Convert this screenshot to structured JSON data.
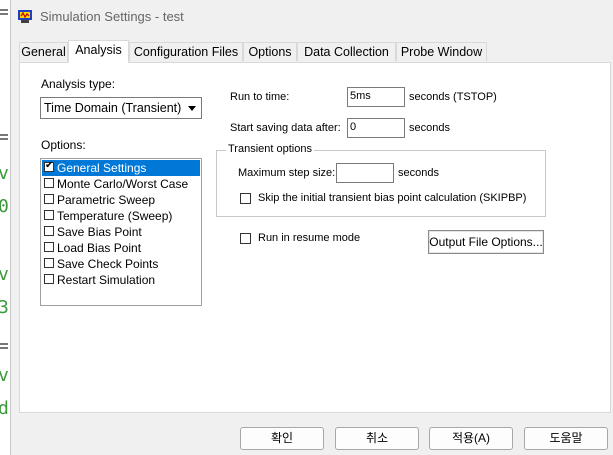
{
  "window": {
    "title": "Simulation Settings - test"
  },
  "tabs": [
    {
      "label": "General"
    },
    {
      "label": "Analysis"
    },
    {
      "label": "Configuration Files"
    },
    {
      "label": "Options"
    },
    {
      "label": "Data Collection"
    },
    {
      "label": "Probe Window"
    }
  ],
  "analysis": {
    "type_label": "Analysis type:",
    "type_value": "Time Domain (Transient)",
    "options_label": "Options:",
    "options": [
      {
        "label": "General Settings",
        "checked": true,
        "selected": true
      },
      {
        "label": "Monte Carlo/Worst Case",
        "checked": false
      },
      {
        "label": "Parametric Sweep",
        "checked": false
      },
      {
        "label": "Temperature (Sweep)",
        "checked": false
      },
      {
        "label": "Save Bias Point",
        "checked": false
      },
      {
        "label": "Load Bias Point",
        "checked": false
      },
      {
        "label": "Save Check Points",
        "checked": false
      },
      {
        "label": "Restart Simulation",
        "checked": false
      }
    ],
    "run_to_time_label": "Run to time:",
    "run_to_time_value": "5ms",
    "run_to_time_unit": "seconds  (TSTOP)",
    "start_saving_label": "Start saving data after:",
    "start_saving_value": "0",
    "start_saving_unit": "seconds",
    "transient_group_title": "Transient options",
    "max_step_label": "Maximum step size:",
    "max_step_value": "",
    "max_step_unit": "seconds",
    "skipbp_label": "Skip the initial transient bias point calculation  (SKIPBP)",
    "resume_label": "Run in resume mode",
    "output_file_button": "Output File Options..."
  },
  "footer": {
    "ok": "확인",
    "cancel": "취소",
    "apply": "적용(A)",
    "help": "도움말"
  },
  "background_text": [
    "v",
    "0",
    "v",
    "3",
    "v",
    "d"
  ]
}
